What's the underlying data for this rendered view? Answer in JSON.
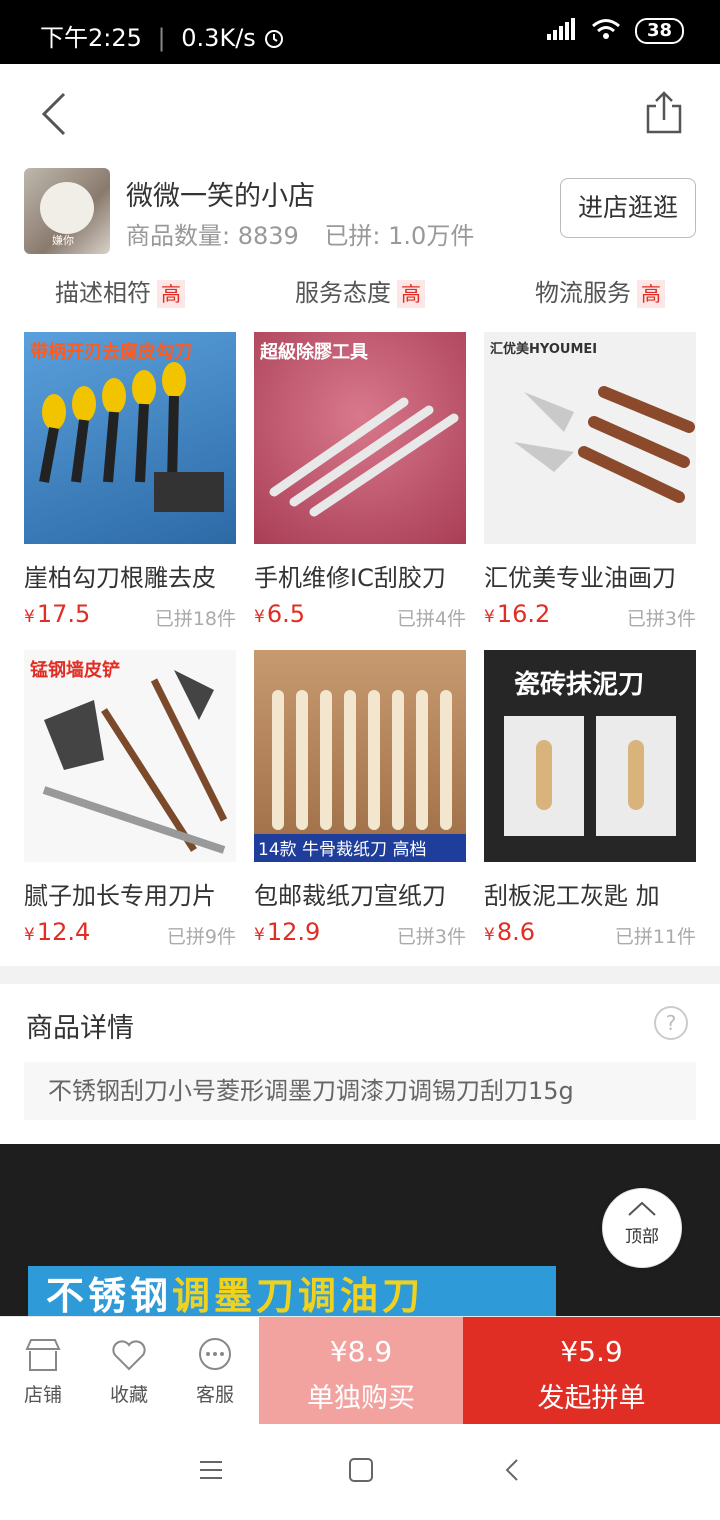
{
  "status_bar": {
    "time": "下午2:25",
    "speed": "0.3K/s",
    "battery": "38",
    "icons": [
      "alarm-icon",
      "signal-icon",
      "wifi-icon",
      "battery-icon"
    ]
  },
  "nav": {
    "back_icon": "back-arrow-icon",
    "share_icon": "share-icon"
  },
  "shop": {
    "name": "微微一笑的小店",
    "product_count_label": "商品数量: 8839",
    "group_count_label": "已拼: 1.0万件",
    "enter_button": "进店逛逛",
    "avatar_caption": "嫌你"
  },
  "ratings": [
    {
      "label": "描述相符",
      "level": "高"
    },
    {
      "label": "服务态度",
      "level": "高"
    },
    {
      "label": "物流服务",
      "level": "高"
    }
  ],
  "products": [
    {
      "title": "崖柏勾刀根雕去皮",
      "currency": "¥",
      "price": "17.5",
      "sold": "已拼18件",
      "image_tag": "带柄开刃去腐皮勾刀",
      "bg": "#3a7fbf"
    },
    {
      "title": "手机维修IC刮胶刀",
      "currency": "¥",
      "price": "6.5",
      "sold": "已拼4件",
      "image_tag": "超級除膠工具",
      "bg": "#c85b70"
    },
    {
      "title": "汇优美专业油画刀",
      "currency": "¥",
      "price": "16.2",
      "sold": "已拼3件",
      "image_tag": "汇优美HYOUMEI",
      "bg": "#ececec"
    },
    {
      "title": "腻子加长专用刀片",
      "currency": "¥",
      "price": "12.4",
      "sold": "已拼9件",
      "image_tag": "锰钢墙皮铲",
      "bg": "#f4f4f4"
    },
    {
      "title": "包邮裁纸刀宣纸刀",
      "currency": "¥",
      "price": "12.9",
      "sold": "已拼3件",
      "image_tag": "14款 牛骨裁纸刀 高档",
      "bg": "#b7855a"
    },
    {
      "title": "刮板泥工灰匙 加",
      "currency": "¥",
      "price": "8.6",
      "sold": "已拼11件",
      "image_tag": "瓷砖抹泥刀",
      "bg": "#2a2a2a"
    }
  ],
  "details": {
    "heading": "商品详情",
    "help_icon": "?",
    "description": "不锈钢刮刀小号菱形调墨刀调漆刀调锡刀刮刀15g"
  },
  "banner": {
    "text_a": "不锈钢",
    "text_b": "调墨刀调油刀"
  },
  "top_button": {
    "label": "顶部"
  },
  "bottom_bar": {
    "tools": [
      {
        "label": "店铺",
        "icon": "store-icon"
      },
      {
        "label": "收藏",
        "icon": "heart-icon"
      },
      {
        "label": "客服",
        "icon": "chat-icon"
      }
    ],
    "single_buy": {
      "price": "¥8.9",
      "label": "单独购买"
    },
    "group_buy": {
      "price": "¥5.9",
      "label": "发起拼单"
    }
  },
  "colors": {
    "accent": "#e02e24",
    "single_buy_bg": "#f2a3a0",
    "rating_bg": "#fde6e6"
  }
}
